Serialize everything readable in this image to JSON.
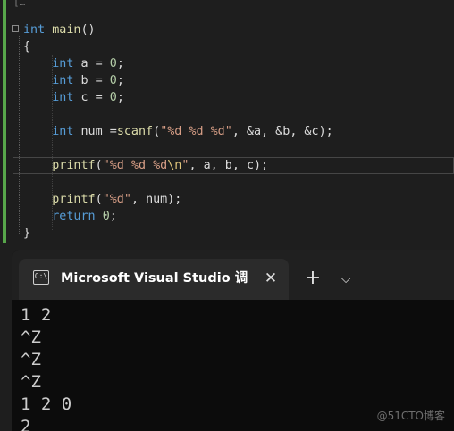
{
  "editor": {
    "lines": [
      {
        "id": "l1",
        "tokens": [
          {
            "t": "int",
            "c": "kw"
          },
          {
            "t": " "
          },
          {
            "t": "main",
            "c": "fn"
          },
          {
            "t": "()"
          }
        ]
      },
      {
        "id": "l2",
        "tokens": [
          {
            "t": "{"
          }
        ]
      },
      {
        "id": "l3",
        "tokens": [
          {
            "t": "    "
          },
          {
            "t": "int",
            "c": "kw"
          },
          {
            "t": " "
          },
          {
            "t": "a",
            "c": "id"
          },
          {
            "t": " = "
          },
          {
            "t": "0",
            "c": "num"
          },
          {
            "t": ";"
          }
        ]
      },
      {
        "id": "l4",
        "tokens": [
          {
            "t": "    "
          },
          {
            "t": "int",
            "c": "kw"
          },
          {
            "t": " "
          },
          {
            "t": "b",
            "c": "id"
          },
          {
            "t": " = "
          },
          {
            "t": "0",
            "c": "num"
          },
          {
            "t": ";"
          }
        ]
      },
      {
        "id": "l5",
        "tokens": [
          {
            "t": "    "
          },
          {
            "t": "int",
            "c": "kw"
          },
          {
            "t": " "
          },
          {
            "t": "c",
            "c": "id"
          },
          {
            "t": " = "
          },
          {
            "t": "0",
            "c": "num"
          },
          {
            "t": ";"
          }
        ]
      },
      {
        "id": "l6",
        "tokens": []
      },
      {
        "id": "l7",
        "tokens": [
          {
            "t": "    "
          },
          {
            "t": "int",
            "c": "kw"
          },
          {
            "t": " "
          },
          {
            "t": "num",
            "c": "id"
          },
          {
            "t": " ="
          },
          {
            "t": "scanf",
            "c": "fn"
          },
          {
            "t": "("
          },
          {
            "t": "\"%d %d %d\"",
            "c": "str"
          },
          {
            "t": ", &"
          },
          {
            "t": "a",
            "c": "id"
          },
          {
            "t": ", &"
          },
          {
            "t": "b",
            "c": "id"
          },
          {
            "t": ", &"
          },
          {
            "t": "c",
            "c": "id"
          },
          {
            "t": ");"
          }
        ]
      },
      {
        "id": "l8",
        "tokens": []
      },
      {
        "id": "l9",
        "tokens": [
          {
            "t": "    "
          },
          {
            "t": "printf",
            "c": "fn"
          },
          {
            "t": "("
          },
          {
            "t": "\"%d %d %d",
            "c": "str"
          },
          {
            "t": "\\n",
            "c": "esc"
          },
          {
            "t": "\"",
            "c": "str"
          },
          {
            "t": ", "
          },
          {
            "t": "a",
            "c": "id"
          },
          {
            "t": ", "
          },
          {
            "t": "b",
            "c": "id"
          },
          {
            "t": ", "
          },
          {
            "t": "c",
            "c": "id"
          },
          {
            "t": ");"
          }
        ]
      },
      {
        "id": "l10",
        "tokens": []
      },
      {
        "id": "l11",
        "tokens": [
          {
            "t": "    "
          },
          {
            "t": "printf",
            "c": "fn"
          },
          {
            "t": "("
          },
          {
            "t": "\"%d\"",
            "c": "str"
          },
          {
            "t": ", "
          },
          {
            "t": "num",
            "c": "id"
          },
          {
            "t": ");"
          }
        ]
      },
      {
        "id": "l12",
        "tokens": [
          {
            "t": "    "
          },
          {
            "t": "return",
            "c": "kw"
          },
          {
            "t": " "
          },
          {
            "t": "0",
            "c": "num"
          },
          {
            "t": ";"
          }
        ]
      },
      {
        "id": "l13",
        "tokens": [
          {
            "t": "}"
          }
        ]
      }
    ],
    "top_stub": "[…"
  },
  "terminal": {
    "tab_title": "Microsoft Visual Studio 调试控制台",
    "tab_icon_glyph": "C:\\",
    "close_glyph": "✕",
    "new_tab_glyph": "+",
    "dropdown_glyph": "⌵",
    "output": [
      "1 2",
      "^Z",
      "^Z",
      "^Z",
      "1 2 0",
      "2"
    ]
  },
  "watermark": "@51CTO博客",
  "colors": {
    "editor_bg": "#1e1e1e",
    "keyword": "#569cd6",
    "function": "#dcdcaa",
    "string": "#d69d85",
    "number": "#b5cea8",
    "terminal_bg": "#0c0c0c",
    "change_bar": "#57a64a"
  }
}
